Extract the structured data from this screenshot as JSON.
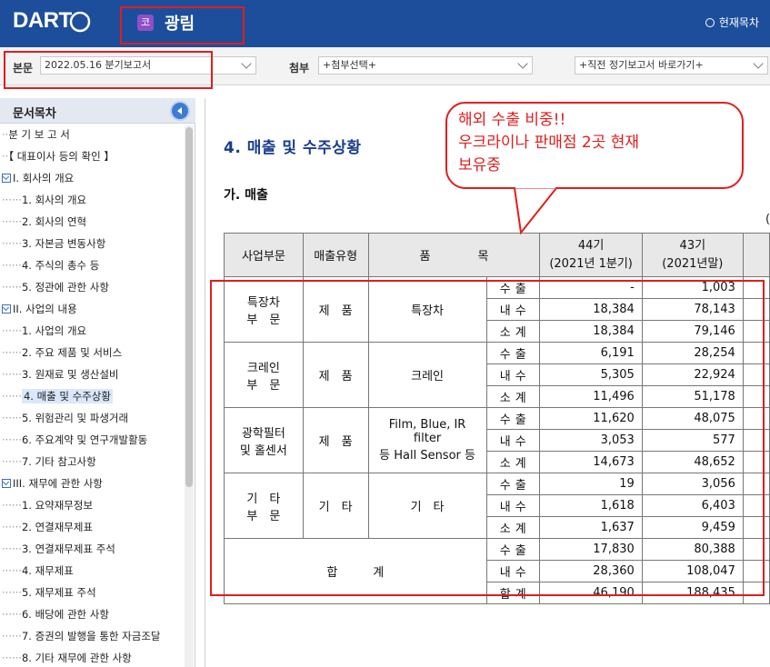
{
  "header": {
    "logo": "DART",
    "company_icon": "코",
    "company_name": "광림",
    "toc_link": "현재목차"
  },
  "selectors": {
    "report_label": "본문",
    "report_value": "2022.05.16  분기보고서",
    "attach_label": "첨부",
    "attach_value": "+첨부선택+",
    "prev_value": "+직전 정기보고서 바로가기+"
  },
  "sidebar": {
    "title": "문서목차",
    "items": [
      {
        "label": "분 기 보 고 서",
        "prefix": "··",
        "indent": 0,
        "box": false,
        "selected": false
      },
      {
        "label": "【 대표이사 등의 확인 】",
        "prefix": "··",
        "indent": 0,
        "box": false,
        "selected": false
      },
      {
        "label": "I. 회사의 개요",
        "prefix": "",
        "indent": 0,
        "box": true,
        "selected": false
      },
      {
        "label": "1. 회사의 개요",
        "prefix": "······",
        "indent": 1,
        "box": false,
        "selected": false
      },
      {
        "label": "2. 회사의 연혁",
        "prefix": "······",
        "indent": 1,
        "box": false,
        "selected": false
      },
      {
        "label": "3. 자본금 변동사항",
        "prefix": "······",
        "indent": 1,
        "box": false,
        "selected": false
      },
      {
        "label": "4. 주식의 총수 등",
        "prefix": "······",
        "indent": 1,
        "box": false,
        "selected": false
      },
      {
        "label": "5. 정관에 관한 사항",
        "prefix": "······",
        "indent": 1,
        "box": false,
        "selected": false
      },
      {
        "label": "II. 사업의 내용",
        "prefix": "",
        "indent": 0,
        "box": true,
        "selected": false
      },
      {
        "label": "1. 사업의 개요",
        "prefix": "······",
        "indent": 1,
        "box": false,
        "selected": false
      },
      {
        "label": "2. 주요 제품 및 서비스",
        "prefix": "······",
        "indent": 1,
        "box": false,
        "selected": false
      },
      {
        "label": "3. 원재료 및 생산설비",
        "prefix": "······",
        "indent": 1,
        "box": false,
        "selected": false
      },
      {
        "label": "4. 매출 및 수주상황",
        "prefix": "······",
        "indent": 1,
        "box": false,
        "selected": true
      },
      {
        "label": "5. 위험관리 및 파생거래",
        "prefix": "······",
        "indent": 1,
        "box": false,
        "selected": false
      },
      {
        "label": "6. 주요계약 및 연구개발활동",
        "prefix": "······",
        "indent": 1,
        "box": false,
        "selected": false
      },
      {
        "label": "7. 기타 참고사항",
        "prefix": "······",
        "indent": 1,
        "box": false,
        "selected": false
      },
      {
        "label": "III. 재무에 관한 사항",
        "prefix": "",
        "indent": 0,
        "box": true,
        "selected": false
      },
      {
        "label": "1. 요약재무정보",
        "prefix": "······",
        "indent": 1,
        "box": false,
        "selected": false
      },
      {
        "label": "2. 연결재무제표",
        "prefix": "······",
        "indent": 1,
        "box": false,
        "selected": false
      },
      {
        "label": "3. 연결재무제표 주석",
        "prefix": "······",
        "indent": 1,
        "box": false,
        "selected": false
      },
      {
        "label": "4. 재무제표",
        "prefix": "······",
        "indent": 1,
        "box": false,
        "selected": false
      },
      {
        "label": "5. 재무제표 주석",
        "prefix": "······",
        "indent": 1,
        "box": false,
        "selected": false
      },
      {
        "label": "6. 배당에 관한 사항",
        "prefix": "······",
        "indent": 1,
        "box": false,
        "selected": false
      },
      {
        "label": "7. 증권의 발행을 통한 자금조달",
        "prefix": "······",
        "indent": 1,
        "box": false,
        "selected": false
      },
      {
        "label": "8. 기타 재무에 관한 사항",
        "prefix": "······",
        "indent": 1,
        "box": false,
        "selected": false
      }
    ]
  },
  "content": {
    "section_title": "4. 매출 및 수주상황",
    "subsection_title": "가. 매출",
    "unit_mark": "(",
    "headers": {
      "division": "사업부문",
      "type": "매출유형",
      "item": "품　　　　목",
      "p44": "44기",
      "p44_sub": "(2021년 1분기)",
      "p43": "43기",
      "p43_sub": "(2021년말)"
    },
    "groups": [
      {
        "division": "특장차\n부　문",
        "type": "제　품",
        "item": "특장차",
        "rows": [
          [
            "수 출",
            "-",
            "1,003"
          ],
          [
            "내 수",
            "18,384",
            "78,143"
          ],
          [
            "소 계",
            "18,384",
            "79,146"
          ]
        ]
      },
      {
        "division": "크레인\n부　문",
        "type": "제　품",
        "item": "크레인",
        "rows": [
          [
            "수 출",
            "6,191",
            "28,254"
          ],
          [
            "내 수",
            "5,305",
            "22,924"
          ],
          [
            "소 계",
            "11,496",
            "51,178"
          ]
        ]
      },
      {
        "division": "광학필터\n및 홀센서",
        "type": "제　품",
        "item": "Film, Blue, IR filter\n등 Hall Sensor 등",
        "rows": [
          [
            "수 출",
            "11,620",
            "48,075"
          ],
          [
            "내 수",
            "3,053",
            "577"
          ],
          [
            "소 계",
            "14,673",
            "48,652"
          ]
        ]
      },
      {
        "division": "기　타\n부　문",
        "type": "기　타",
        "item": "기　타",
        "rows": [
          [
            "수 출",
            "19",
            "3,056"
          ],
          [
            "내 수",
            "1,618",
            "6,403"
          ],
          [
            "소 계",
            "1,637",
            "9,459"
          ]
        ]
      }
    ],
    "total": {
      "label": "합　　　계",
      "rows": [
        [
          "수 출",
          "17,830",
          "80,388"
        ],
        [
          "내 수",
          "28,360",
          "108,047"
        ],
        [
          "합 계",
          "46,190",
          "188,435"
        ]
      ]
    }
  },
  "annotation": {
    "text_line1": "해외 수출 비중!!",
    "text_line2": "우크라이나 판매점 2곳  현재",
    "text_line3": "보유중",
    "color": "#e11d1d"
  }
}
